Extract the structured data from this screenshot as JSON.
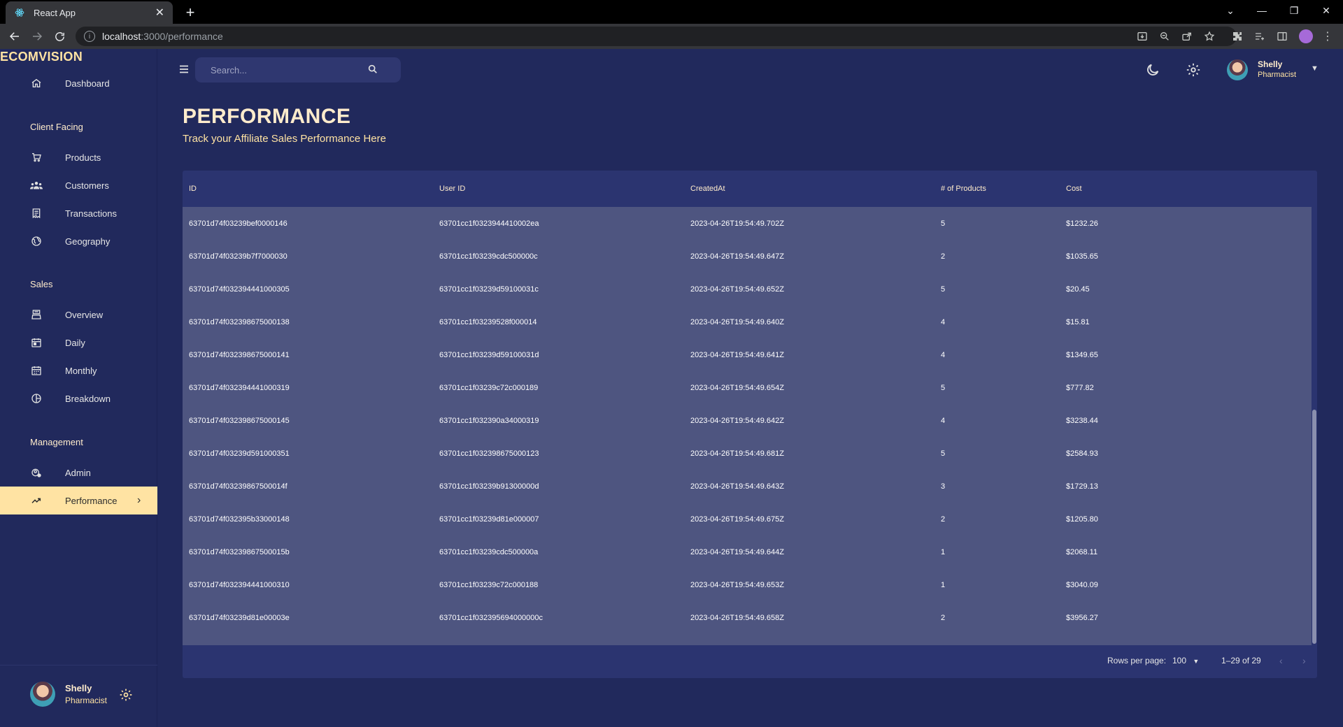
{
  "browser": {
    "tab_title": "React App",
    "url_host": "localhost",
    "url_path": ":3000/performance"
  },
  "sidebar": {
    "brand": "ECOMVISION",
    "items": [
      {
        "label": "Dashboard",
        "icon": "home-icon"
      },
      {
        "heading": "Client Facing"
      },
      {
        "label": "Products",
        "icon": "cart-icon"
      },
      {
        "label": "Customers",
        "icon": "groups-icon"
      },
      {
        "label": "Transactions",
        "icon": "receipt-icon"
      },
      {
        "label": "Geography",
        "icon": "globe-icon"
      },
      {
        "heading": "Sales"
      },
      {
        "label": "Overview",
        "icon": "point-of-sale-icon"
      },
      {
        "label": "Daily",
        "icon": "calendar-day-icon"
      },
      {
        "label": "Monthly",
        "icon": "calendar-month-icon"
      },
      {
        "label": "Breakdown",
        "icon": "pie-chart-icon"
      },
      {
        "heading": "Management"
      },
      {
        "label": "Admin",
        "icon": "admin-icon"
      },
      {
        "label": "Performance",
        "icon": "trending-up-icon",
        "active": true
      }
    ],
    "user": {
      "name": "Shelly",
      "role": "Pharmacist"
    }
  },
  "topbar": {
    "search_placeholder": "Search...",
    "user": {
      "name": "Shelly",
      "role": "Pharmacist"
    }
  },
  "header": {
    "title": "PERFORMANCE",
    "subtitle": "Track your Affiliate Sales Performance Here"
  },
  "table": {
    "columns": [
      "ID",
      "User ID",
      "CreatedAt",
      "# of Products",
      "Cost"
    ],
    "rows": [
      [
        "63701d74f03239bef0000146",
        "63701cc1f0323944410002ea",
        "2023-04-26T19:54:49.702Z",
        "5",
        "$1232.26"
      ],
      [
        "63701d74f03239b7f7000030",
        "63701cc1f03239cdc500000c",
        "2023-04-26T19:54:49.647Z",
        "2",
        "$1035.65"
      ],
      [
        "63701d74f032394441000305",
        "63701cc1f03239d59100031c",
        "2023-04-26T19:54:49.652Z",
        "5",
        "$20.45"
      ],
      [
        "63701d74f032398675000138",
        "63701cc1f03239528f000014",
        "2023-04-26T19:54:49.640Z",
        "4",
        "$15.81"
      ],
      [
        "63701d74f032398675000141",
        "63701cc1f03239d59100031d",
        "2023-04-26T19:54:49.641Z",
        "4",
        "$1349.65"
      ],
      [
        "63701d74f032394441000319",
        "63701cc1f03239c72c000189",
        "2023-04-26T19:54:49.654Z",
        "5",
        "$777.82"
      ],
      [
        "63701d74f032398675000145",
        "63701cc1f032390a34000319",
        "2023-04-26T19:54:49.642Z",
        "4",
        "$3238.44"
      ],
      [
        "63701d74f03239d591000351",
        "63701cc1f032398675000123",
        "2023-04-26T19:54:49.681Z",
        "5",
        "$2584.93"
      ],
      [
        "63701d74f03239867500014f",
        "63701cc1f03239b91300000d",
        "2023-04-26T19:54:49.643Z",
        "3",
        "$1729.13"
      ],
      [
        "63701d74f032395b33000148",
        "63701cc1f03239d81e000007",
        "2023-04-26T19:54:49.675Z",
        "2",
        "$1205.80"
      ],
      [
        "63701d74f03239867500015b",
        "63701cc1f03239cdc500000a",
        "2023-04-26T19:54:49.644Z",
        "1",
        "$2068.11"
      ],
      [
        "63701d74f032394441000310",
        "63701cc1f03239c72c000188",
        "2023-04-26T19:54:49.653Z",
        "1",
        "$3040.09"
      ],
      [
        "63701d74f03239d81e00003e",
        "63701cc1f032395694000000c",
        "2023-04-26T19:54:49.658Z",
        "2",
        "$3956.27"
      ]
    ],
    "footer": {
      "rows_per_page_label": "Rows per page:",
      "rows_per_page_value": "100",
      "range": "1–29 of 29"
    }
  },
  "colors": {
    "background": "#21295c",
    "accent": "#ffe3a3",
    "row_bg": "#4e5580"
  }
}
